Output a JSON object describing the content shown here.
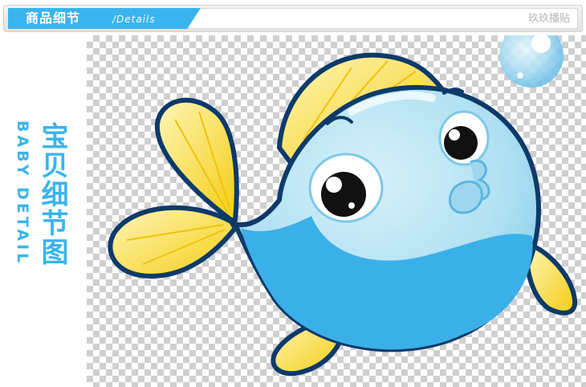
{
  "header": {
    "title": "商品细节",
    "subtitle": "/Details",
    "brand": "玖玖播贴"
  },
  "side": {
    "english": "BABY DETAIL",
    "chinese": "宝贝细节图"
  },
  "colors": {
    "accent": "#3ab4ee",
    "fish_body": "#aee0f2",
    "fish_belly": "#3bb0e8",
    "fin": "#f6d21f",
    "outline": "#0e3a6a"
  },
  "image": {
    "subject": "cartoon-fish",
    "background": "transparent-checkerboard"
  }
}
